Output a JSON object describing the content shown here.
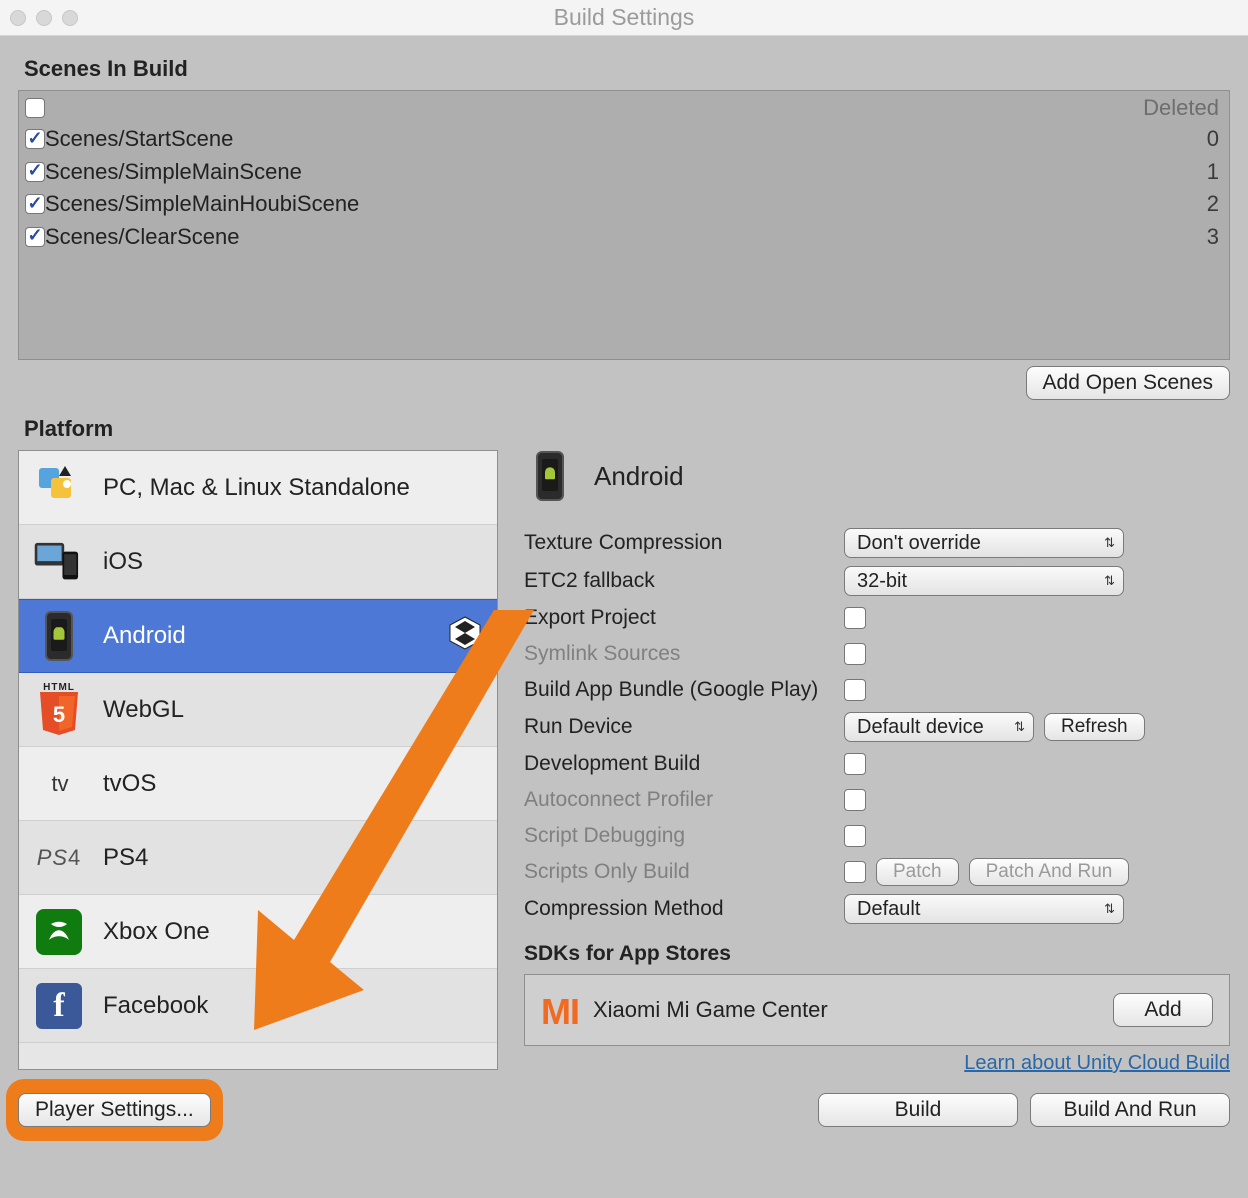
{
  "window": {
    "title": "Build Settings"
  },
  "scenes": {
    "heading": "Scenes In Build",
    "deleted_label": "Deleted",
    "add_open_scenes": "Add Open Scenes",
    "items": [
      {
        "name": "Scenes/StartScene",
        "index": "0"
      },
      {
        "name": "Scenes/SimpleMainScene",
        "index": "1"
      },
      {
        "name": "Scenes/SimpleMainHoubiScene",
        "index": "2"
      },
      {
        "name": "Scenes/ClearScene",
        "index": "3"
      }
    ]
  },
  "platforms": {
    "heading": "Platform",
    "items": [
      {
        "label": "PC, Mac & Linux Standalone"
      },
      {
        "label": "iOS"
      },
      {
        "label": "Android"
      },
      {
        "label": "WebGL"
      },
      {
        "label": "tvOS"
      },
      {
        "label": "PS4"
      },
      {
        "label": "Xbox One"
      },
      {
        "label": "Facebook"
      }
    ]
  },
  "android": {
    "title": "Android",
    "rows": {
      "texture_compression": {
        "label": "Texture Compression",
        "value": "Don't override"
      },
      "etc2_fallback": {
        "label": "ETC2 fallback",
        "value": "32-bit"
      },
      "export_project": {
        "label": "Export Project"
      },
      "symlink_sources": {
        "label": "Symlink Sources"
      },
      "build_app_bundle": {
        "label": "Build App Bundle (Google Play)"
      },
      "run_device": {
        "label": "Run Device",
        "value": "Default device",
        "refresh": "Refresh"
      },
      "development_build": {
        "label": "Development Build"
      },
      "autoconnect_profiler": {
        "label": "Autoconnect Profiler"
      },
      "script_debugging": {
        "label": "Script Debugging"
      },
      "scripts_only_build": {
        "label": "Scripts Only Build",
        "patch": "Patch",
        "patch_run": "Patch And Run"
      },
      "compression_method": {
        "label": "Compression Method",
        "value": "Default"
      }
    },
    "sdk": {
      "heading": "SDKs for App Stores",
      "store_name": "Xiaomi Mi Game Center",
      "add": "Add"
    },
    "cloud_link": "Learn about Unity Cloud Build"
  },
  "bottom": {
    "player_settings": "Player Settings...",
    "build": "Build",
    "build_and_run": "Build And Run"
  }
}
